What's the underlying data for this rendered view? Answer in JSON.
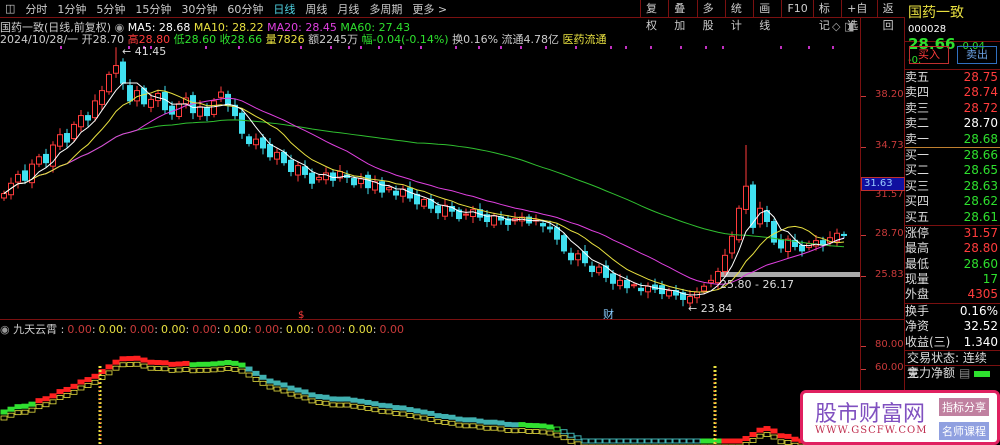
{
  "toolbar": {
    "tabs": [
      "分时",
      "1分钟",
      "5分钟",
      "15分钟",
      "30分钟",
      "60分钟",
      "日线",
      "周线",
      "月线",
      "多周期",
      "更多 >"
    ],
    "active": "日线",
    "buttons": [
      "复权",
      "叠加",
      "多股",
      "统计",
      "画线",
      "F10",
      "标记",
      "+自选",
      "返回"
    ]
  },
  "info": {
    "title": "国药一致(日线,前复权)",
    "ma5": "MA5: 28.68",
    "ma10": "MA10: 28.22",
    "ma20": "MA20: 28.45",
    "ma60": "MA60: 27.43",
    "date": "2024/10/28/一",
    "open": "开28.70",
    "high": "高28.80",
    "low": "低28.60",
    "close": "收28.66",
    "vol": "量7826",
    "amount": "额2245万",
    "change": "幅-0.04(-0.14%)",
    "turnover": "换0.16%",
    "float": "流通4.78亿",
    "sector": "医药流通"
  },
  "axis": {
    "price_ticks": [
      "38.20",
      "34.73",
      "31.57",
      "28.70",
      "25.83"
    ],
    "current": "31.63",
    "ind_ticks": [
      "80.00",
      "60.00"
    ]
  },
  "annotations": {
    "high": "41.45",
    "low": "← 23.84",
    "range": "25.80 - 26.17",
    "cai": "财",
    "dollar": "$"
  },
  "indicator": {
    "name": "九天云霄",
    "values": [
      "0.00",
      "0.00",
      "0.00",
      "0.00",
      "0.00",
      "0.00",
      "0.00",
      "0.00",
      "0.00",
      "0.00",
      "0.00"
    ]
  },
  "quote": {
    "name": "国药一致",
    "code": "000028",
    "price": "28.66",
    "change": "-0.04",
    "pct": "-0.",
    "buy": "买入",
    "sell": "卖出",
    "asks": [
      [
        "卖五",
        "28.75"
      ],
      [
        "卖四",
        "28.74"
      ],
      [
        "卖三",
        "28.72"
      ],
      [
        "卖二",
        "28.70"
      ],
      [
        "卖一",
        "28.68"
      ]
    ],
    "bids": [
      [
        "买一",
        "28.66"
      ],
      [
        "买二",
        "28.65"
      ],
      [
        "买三",
        "28.63"
      ],
      [
        "买四",
        "28.62"
      ],
      [
        "买五",
        "28.61"
      ]
    ],
    "stats": [
      [
        "涨停",
        "31.57"
      ],
      [
        "最高",
        "28.80"
      ],
      [
        "最低",
        "28.60"
      ],
      [
        "现量",
        "17"
      ],
      [
        "外盘",
        "4305"
      ]
    ],
    "stats2": [
      [
        "换手",
        "0.16%"
      ],
      [
        "净资",
        "32.52"
      ],
      [
        "收益(三)",
        "1.340"
      ]
    ],
    "status": "交易状态: 连续竞",
    "netflow": "主力净额"
  },
  "ad": {
    "title": "股市财富网",
    "url": "WWW.GSCFW.COM",
    "tag1": "指标分享",
    "tag2": "名师课程"
  },
  "chart_data": {
    "type": "candlestick",
    "closes": [
      31.5,
      32.2,
      32.8,
      32.4,
      33.5,
      34.0,
      33.6,
      34.8,
      35.5,
      35.0,
      36.2,
      36.8,
      36.5,
      37.8,
      38.5,
      39.6,
      40.2,
      39.0,
      37.8,
      38.5,
      37.6,
      37.9,
      38.3,
      37.2,
      36.9,
      37.6,
      38.0,
      37.0,
      37.4,
      36.8,
      37.8,
      38.4,
      37.5,
      36.8,
      35.6,
      34.9,
      35.2,
      34.6,
      34.0,
      34.3,
      33.6,
      33.0,
      33.4,
      32.8,
      32.2,
      32.6,
      32.9,
      32.4,
      33.0,
      32.6,
      32.1,
      32.5,
      31.9,
      32.3,
      31.6,
      31.9,
      31.4,
      31.8,
      31.2,
      30.8,
      31.1,
      30.5,
      30.2,
      30.7,
      30.3,
      29.8,
      30.1,
      30.4,
      29.9,
      29.6,
      30.0,
      29.7,
      29.4,
      29.8,
      29.9,
      29.5,
      29.7,
      29.3,
      29.1,
      28.4,
      27.6,
      27.0,
      27.4,
      26.8,
      26.2,
      26.5,
      25.8,
      25.4,
      25.6,
      25.1,
      25.3,
      24.9,
      25.2,
      25.0,
      24.7,
      24.9,
      24.6,
      24.3,
      24.5,
      24.8,
      25.2,
      25.6,
      26.2,
      27.3,
      28.6,
      30.5,
      32.0,
      29.2,
      30.5,
      29.6,
      28.2,
      27.8,
      28.4,
      27.9,
      27.6,
      28.1,
      28.3,
      28.0,
      28.5,
      28.8,
      28.66
    ],
    "overrides": [
      {
        "index": 16,
        "high": 41.45
      },
      {
        "index": 106,
        "high": 34.8
      },
      {
        "index": 97,
        "low": 23.84
      }
    ],
    "ma_colors": {
      "ma5": "#ffffff",
      "ma10": "#e8e040",
      "ma20": "#e040e0",
      "ma60": "#30c030"
    },
    "up": "#ff3c3c",
    "down": "#40e0f0"
  }
}
